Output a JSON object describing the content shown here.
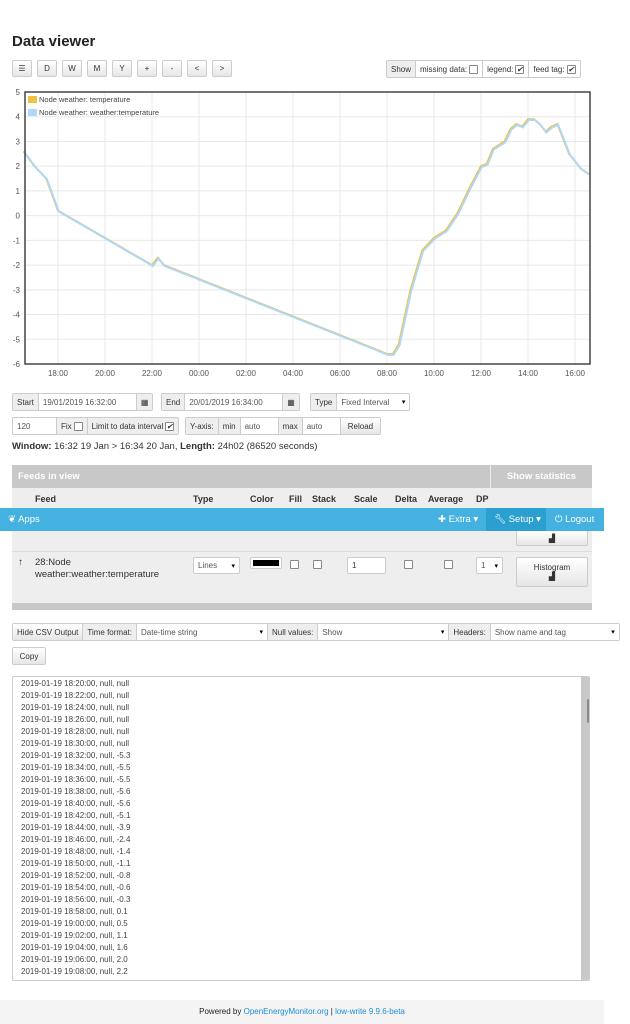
{
  "title": "Data viewer",
  "toolbar": {
    "buttons": [
      "☰",
      "D",
      "W",
      "M",
      "Y",
      "+",
      "-",
      "<",
      ">"
    ],
    "show": "Show",
    "missing_data": "missing data:",
    "missing_checked": false,
    "legend": "legend:",
    "legend_checked": true,
    "feed_tag": "feed tag:",
    "feed_tag_checked": true
  },
  "chart_data": {
    "type": "line",
    "ylim": [
      -6,
      5
    ],
    "yticks": [
      "5",
      "4",
      "3",
      "2",
      "1",
      "0",
      "-1",
      "-2",
      "-3",
      "-4",
      "-5",
      "-6"
    ],
    "xticks": [
      "18:00",
      "20:00",
      "22:00",
      "00:00",
      "02:00",
      "04:00",
      "06:00",
      "08:00",
      "10:00",
      "12:00",
      "14:00",
      "16:00"
    ],
    "legend": "top-left",
    "grid": true,
    "series": [
      {
        "name": "Node weather: temperature",
        "color": "#edc240"
      },
      {
        "name": "Node weather: weather:temperature",
        "color": "#afd8f8"
      }
    ],
    "points": [
      [
        "2019-01-19 16:32",
        2.6
      ],
      [
        "2019-01-19 17:00",
        2.0
      ],
      [
        "2019-01-19 17:30",
        1.5
      ],
      [
        "2019-01-19 18:00",
        0.2
      ],
      [
        "2019-01-19 22:00",
        -2.0
      ],
      [
        "2019-01-19 22:15",
        -1.7
      ],
      [
        "2019-01-19 22:30",
        -2.0
      ],
      [
        "2019-01-20 07:30",
        -5.4
      ],
      [
        "2019-01-20 07:45",
        -5.5
      ],
      [
        "2019-01-20 08:00",
        -5.6
      ],
      [
        "2019-01-20 08:15",
        -5.6
      ],
      [
        "2019-01-20 08:30",
        -5.2
      ],
      [
        "2019-01-20 09:00",
        -3.0
      ],
      [
        "2019-01-20 09:30",
        -1.4
      ],
      [
        "2019-01-20 10:00",
        -0.9
      ],
      [
        "2019-01-20 10:30",
        -0.6
      ],
      [
        "2019-01-20 11:00",
        0.1
      ],
      [
        "2019-01-20 11:30",
        1.1
      ],
      [
        "2019-01-20 12:00",
        2.0
      ],
      [
        "2019-01-20 12:15",
        2.1
      ],
      [
        "2019-01-20 12:30",
        2.7
      ],
      [
        "2019-01-20 13:00",
        3.0
      ],
      [
        "2019-01-20 13:15",
        3.5
      ],
      [
        "2019-01-20 13:30",
        3.7
      ],
      [
        "2019-01-20 13:45",
        3.6
      ],
      [
        "2019-01-20 14:00",
        3.9
      ],
      [
        "2019-01-20 14:15",
        3.9
      ],
      [
        "2019-01-20 14:30",
        3.7
      ],
      [
        "2019-01-20 14:45",
        3.4
      ],
      [
        "2019-01-20 15:00",
        3.6
      ],
      [
        "2019-01-20 15:15",
        3.7
      ],
      [
        "2019-01-20 15:45",
        2.5
      ],
      [
        "2019-01-20 16:15",
        1.9
      ],
      [
        "2019-01-20 16:34",
        1.7
      ]
    ]
  },
  "controls": {
    "start_label": "Start",
    "start": "19/01/2019 16:32:00",
    "end_label": "End",
    "end": "20/01/2019 16:34:00",
    "type_label": "Type",
    "type": "Fixed Interval",
    "interval": "120",
    "fix": "Fix",
    "limit": "Limit to data interval",
    "yaxis": "Y-axis:",
    "min_label": "min",
    "min": "auto",
    "max_label": "max",
    "max": "auto",
    "reload": "Reload"
  },
  "window": {
    "w_label": "Window:",
    "w": " 16:32 19 Jan > 16:34 20 Jan, ",
    "l_label": "Length:",
    "l": " 24h02 (86520 seconds)"
  },
  "feeds": {
    "title": "Feeds in view",
    "stats": "Show statistics",
    "headers": [
      "Feed",
      "Type",
      "Color",
      "Fill",
      "Stack",
      "Scale",
      "Delta",
      "Average",
      "DP"
    ],
    "row": {
      "name": "28:Node weather:weather:temperature",
      "type": "Lines",
      "color": "#000000",
      "scale": "1",
      "dp": "1",
      "histogram": "Histogram"
    }
  },
  "nav": {
    "apps": "Apps",
    "extra": "Extra",
    "setup": "Setup",
    "logout": "Logout"
  },
  "csv": {
    "hide": "Hide CSV Output",
    "time_format_label": "Time format:",
    "time_format": "Date-time string",
    "null_label": "Null values:",
    "null": "Show",
    "headers_label": "Headers:",
    "headers": "Show name and tag",
    "copy": "Copy",
    "lines": [
      "2019-01-19 18:20:00, null, null",
      "2019-01-19 18:22:00, null, null",
      "2019-01-19 18:24:00, null, null",
      "2019-01-19 18:26:00, null, null",
      "2019-01-19 18:28:00, null, null",
      "2019-01-19 18:30:00, null, null",
      "2019-01-19 18:32:00, null, -5.3",
      "2019-01-19 18:34:00, null, -5.5",
      "2019-01-19 18:36:00, null, -5.5",
      "2019-01-19 18:38:00, null, -5.6",
      "2019-01-19 18:40:00, null, -5.6",
      "2019-01-19 18:42:00, null, -5.1",
      "2019-01-19 18:44:00, null, -3.9",
      "2019-01-19 18:46:00, null, -2.4",
      "2019-01-19 18:48:00, null, -1.4",
      "2019-01-19 18:50:00, null, -1.1",
      "2019-01-19 18:52:00, null, -0.8",
      "2019-01-19 18:54:00, null, -0.6",
      "2019-01-19 18:56:00, null, -0.3",
      "2019-01-19 18:58:00, null, 0.1",
      "2019-01-19 19:00:00, null, 0.5",
      "2019-01-19 19:02:00, null, 1.1",
      "2019-01-19 19:04:00, null, 1.6",
      "2019-01-19 19:06:00, null, 2.0",
      "2019-01-19 19:08:00, null, 2.2"
    ]
  },
  "footer": {
    "powered": "Powered by ",
    "link": "OpenEnergyMonitor.org",
    "sep": " | ",
    "version": "low-write 9.9.6-beta"
  }
}
